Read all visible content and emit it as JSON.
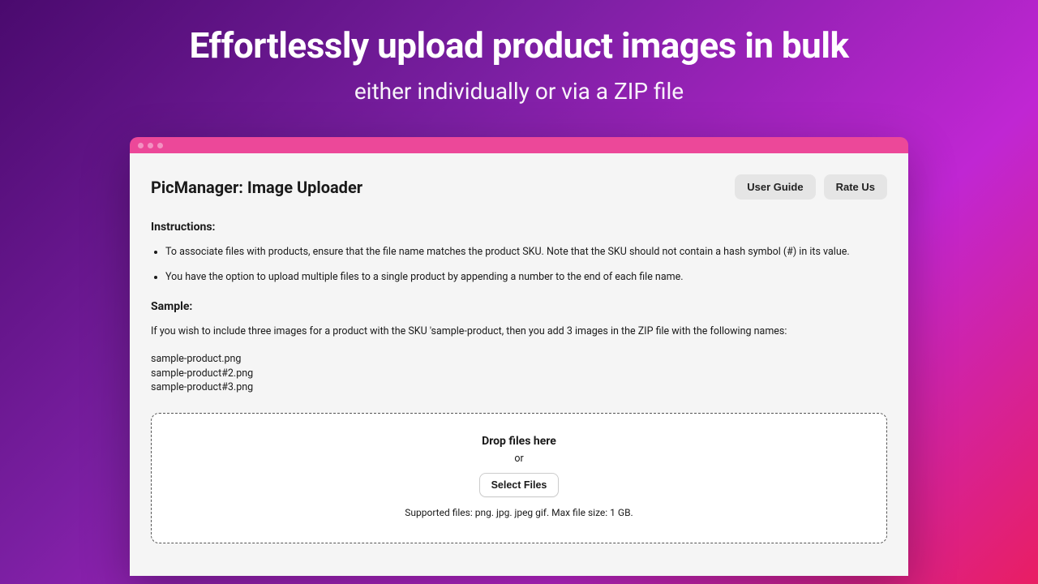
{
  "hero": {
    "title": "Effortlessly upload product images in bulk",
    "subtitle": "either individually or via a ZIP file"
  },
  "app": {
    "title": "PicManager: Image Uploader",
    "buttons": {
      "guide": "User Guide",
      "rate": "Rate Us"
    },
    "instructions": {
      "label": "Instructions:",
      "items": [
        "To associate files with products, ensure that the file name matches the product SKU. Note that the SKU should not contain a hash symbol (#) in its value.",
        "You have the option to upload multiple files to a single product by appending a number to the end of each file name."
      ]
    },
    "sample": {
      "label": "Sample:",
      "desc": "If you wish to include three images for a product with the SKU 'sample-product, then you add 3 images in the ZIP file with the following names:",
      "files": "sample-product.png\nsample-product#2.png\nsample-product#3.png"
    },
    "dropzone": {
      "title": "Drop files here",
      "or": "or",
      "select": "Select Files",
      "support": "Supported files: png. jpg. jpeg gif. Max file size: 1 GB."
    }
  }
}
